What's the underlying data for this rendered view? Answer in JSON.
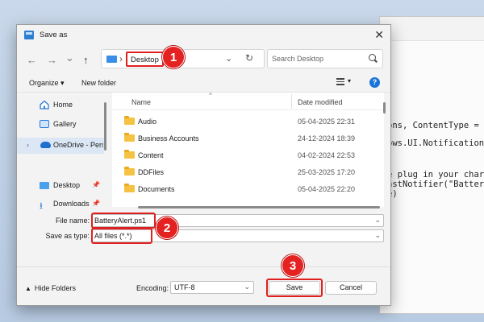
{
  "dialog": {
    "title": "Save as",
    "close_glyph": "✕"
  },
  "nav": {
    "back": "←",
    "forward": "→",
    "recent": "⌄",
    "up": "↑",
    "address_sep": "›",
    "address_crumb": "Desktop",
    "address_dropdown": "⌄",
    "refresh": "↻",
    "search_placeholder": "Search Desktop"
  },
  "toolbar": {
    "organize": "Organize ▾",
    "new_folder": "New folder",
    "view_chevron": "▾",
    "help": "?"
  },
  "sidebar": {
    "items": [
      {
        "label": "Home",
        "icon": "home-icon"
      },
      {
        "label": "Gallery",
        "icon": "gallery-icon"
      },
      {
        "label": "OneDrive - Perso",
        "icon": "onedrive-icon",
        "expand": "›"
      },
      {
        "label": "Desktop",
        "icon": "desktop-icon"
      },
      {
        "label": "Downloads",
        "icon": "downloads-icon"
      }
    ]
  },
  "filelist": {
    "columns": {
      "name": "Name",
      "date": "Date modified"
    },
    "rows": [
      {
        "name": "Audio",
        "date": "05-04-2025 22:31"
      },
      {
        "name": "Business Accounts",
        "date": "24-12-2024 18:39"
      },
      {
        "name": "Content",
        "date": "04-02-2024 22:53"
      },
      {
        "name": "DDFiles",
        "date": "25-03-2025 17:20"
      },
      {
        "name": "Documents",
        "date": "05-04-2025 22:20"
      }
    ]
  },
  "form": {
    "filename_label": "File name:",
    "filename_value": "BatteryAlert.ps1",
    "savetype_label": "Save as type:",
    "savetype_value": "All files  (*.*)",
    "chevron": "⌄"
  },
  "footer": {
    "hide_folders": "Hide Folders",
    "hide_caret": "▲",
    "encoding_label": "Encoding:",
    "encoding_value": "UTF-8",
    "save": "Save",
    "cancel": "Cancel"
  },
  "callouts": [
    "1",
    "2",
    "3"
  ],
  "background_code": [
    "ons, ContentType = Wi",
    "ows.UI.Notifications",
    "e plug in your charge",
    "astNotifier(\"Battery",
    "e)"
  ],
  "colors": {
    "accent": "#1a73d9",
    "highlight": "#e02020",
    "folder": "#f6c243"
  }
}
